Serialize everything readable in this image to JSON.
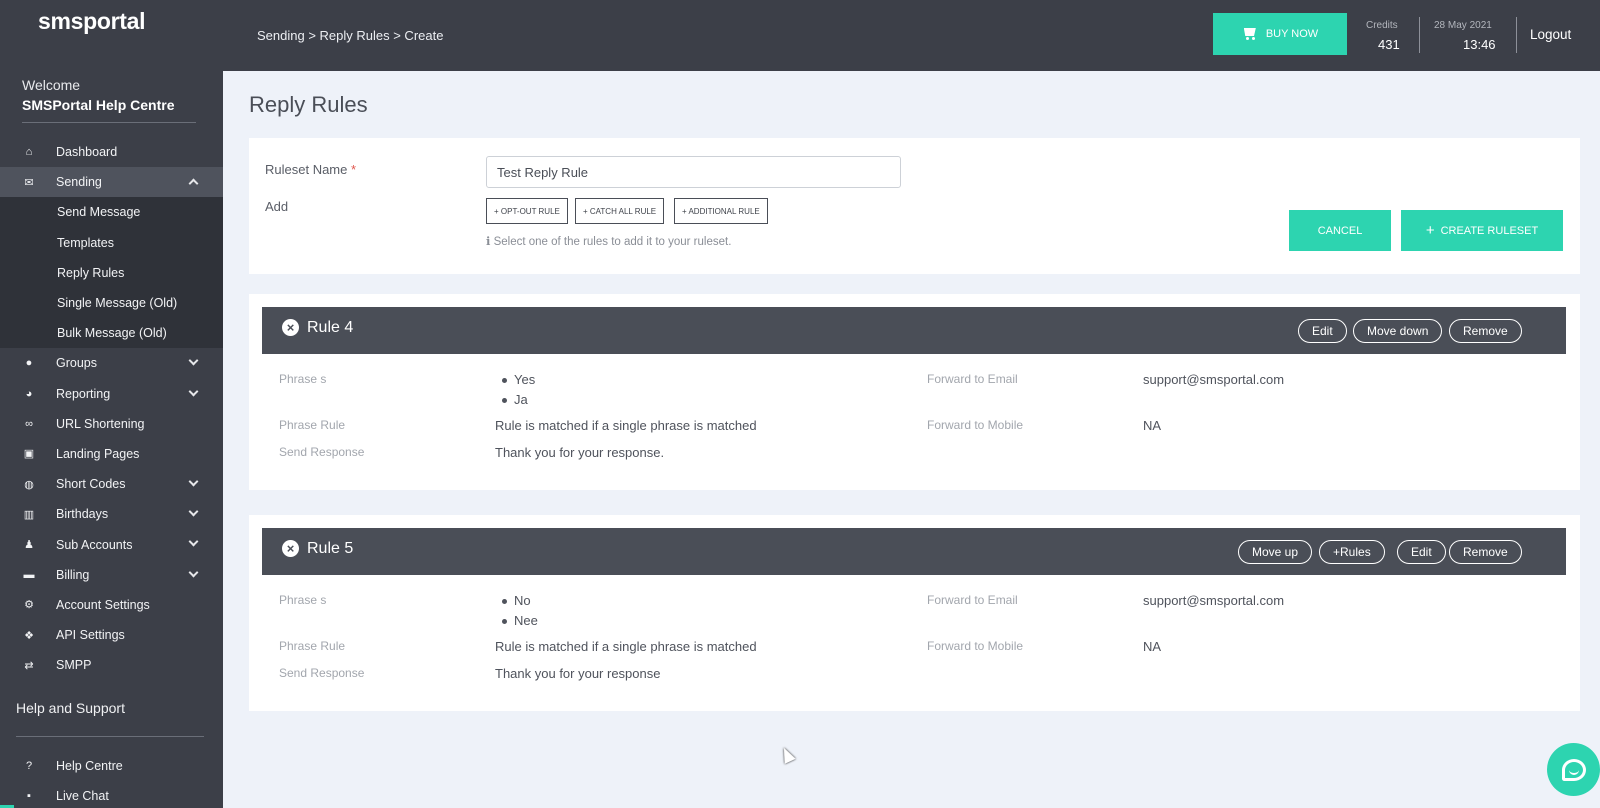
{
  "app": {
    "logo": "smsportal"
  },
  "sidebar": {
    "welcome": "Welcome",
    "account_name": "SMSPortal Help Centre",
    "items": [
      {
        "label": "Dashboard",
        "icon": "home-icon",
        "has_children": false
      },
      {
        "label": "Sending",
        "icon": "envelope-icon",
        "has_children": true,
        "open": true,
        "children": [
          "Send Message",
          "Templates",
          "Reply Rules",
          "Single Message (Old)",
          "Bulk Message (Old)"
        ]
      },
      {
        "label": "Groups",
        "icon": "users-icon",
        "has_children": true
      },
      {
        "label": "Reporting",
        "icon": "chart-icon",
        "has_children": true
      },
      {
        "label": "URL Shortening",
        "icon": "link-icon",
        "has_children": false
      },
      {
        "label": "Landing Pages",
        "icon": "window-icon",
        "has_children": false
      },
      {
        "label": "Short Codes",
        "icon": "chat-bubbles-icon",
        "has_children": true
      },
      {
        "label": "Birthdays",
        "icon": "cake-icon",
        "has_children": true
      },
      {
        "label": "Sub Accounts",
        "icon": "user-plus-icon",
        "has_children": true
      },
      {
        "label": "Billing",
        "icon": "credit-card-icon",
        "has_children": true
      },
      {
        "label": "Account Settings",
        "icon": "gears-icon",
        "has_children": false
      },
      {
        "label": "API Settings",
        "icon": "cubes-icon",
        "has_children": false
      },
      {
        "label": "SMPP",
        "icon": "exchange-icon",
        "has_children": false
      }
    ],
    "help_heading": "Help and Support",
    "help_items": [
      {
        "label": "Help Centre",
        "icon": "question-icon"
      },
      {
        "label": "Live Chat",
        "icon": "comment-icon"
      }
    ]
  },
  "header": {
    "breadcrumb": "Sending > Reply Rules > Create",
    "buy_label": "BUY NOW",
    "credits_label": "Credits",
    "credits_value": "431",
    "date": "28 May 2021",
    "time": "13:46",
    "logout": "Logout"
  },
  "page": {
    "title": "Reply Rules",
    "form": {
      "ruleset_label": "Ruleset Name",
      "required_mark": "*",
      "ruleset_value": "Test Reply Rule",
      "add_label": "Add",
      "add_buttons": [
        "+ OPT-OUT RULE",
        "+ CATCH ALL RULE",
        "+ ADDITIONAL RULE"
      ],
      "hint": "Select one of the rules to add it to your ruleset.",
      "cancel": "CANCEL",
      "create": "CREATE RULESET"
    },
    "rules": [
      {
        "title": "Rule 4",
        "actions": [
          "Edit",
          "Move down",
          "Remove"
        ],
        "phrases_label": "Phrase s",
        "phrases": [
          "Yes",
          "Ja"
        ],
        "phrase_rule_label": "Phrase Rule",
        "phrase_rule": "Rule is matched if a single phrase is matched",
        "send_response_label": "Send Response",
        "send_response": "Thank you for your response.",
        "email_label": "Forward to Email",
        "email": "support@smsportal.com",
        "mobile_label": "Forward to Mobile",
        "mobile": "NA"
      },
      {
        "title": "Rule 5",
        "actions": [
          "Move up",
          "Rules",
          "Edit",
          "Remove"
        ],
        "phrases_label": "Phrase s",
        "phrases": [
          "No",
          "Nee"
        ],
        "phrase_rule_label": "Phrase Rule",
        "phrase_rule": "Rule is matched if a single phrase is matched",
        "send_response_label": "Send Response",
        "send_response": "Thank you for your response",
        "email_label": "Forward to Email",
        "email": "support@smsportal.com",
        "mobile_label": "Forward to Mobile",
        "mobile": "NA"
      }
    ]
  },
  "colors": {
    "accent": "#2dd4b0",
    "sidebar": "#3c3f48",
    "rule_header": "#4a4e57"
  }
}
